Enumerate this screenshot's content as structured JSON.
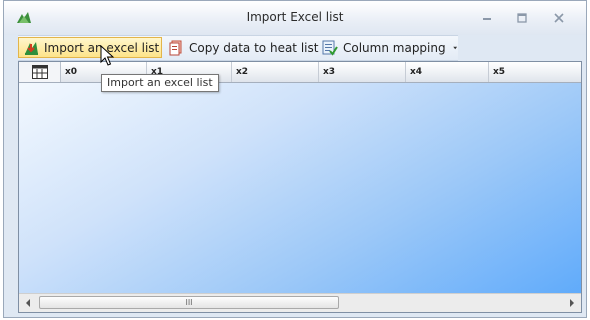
{
  "window": {
    "title": "Import Excel list",
    "app_icon": "excel-import-icon",
    "controls": [
      "minimize-icon",
      "maximize-icon",
      "close-icon"
    ]
  },
  "toolbar": {
    "import_label": "Import an excel list",
    "copy_label": "Copy data to heat list",
    "mapping_label": "Column mapping"
  },
  "grid": {
    "columns": [
      "x0",
      "x1",
      "x2",
      "x3",
      "x4",
      "x5"
    ]
  },
  "tooltip": {
    "text": "Import an excel list"
  },
  "scrollbar": {
    "grip": "III"
  },
  "colors": {
    "hover_button": "#fde48a",
    "grid_gradient_end": "#5aa8fb",
    "title_bar": "#e9eef6"
  }
}
